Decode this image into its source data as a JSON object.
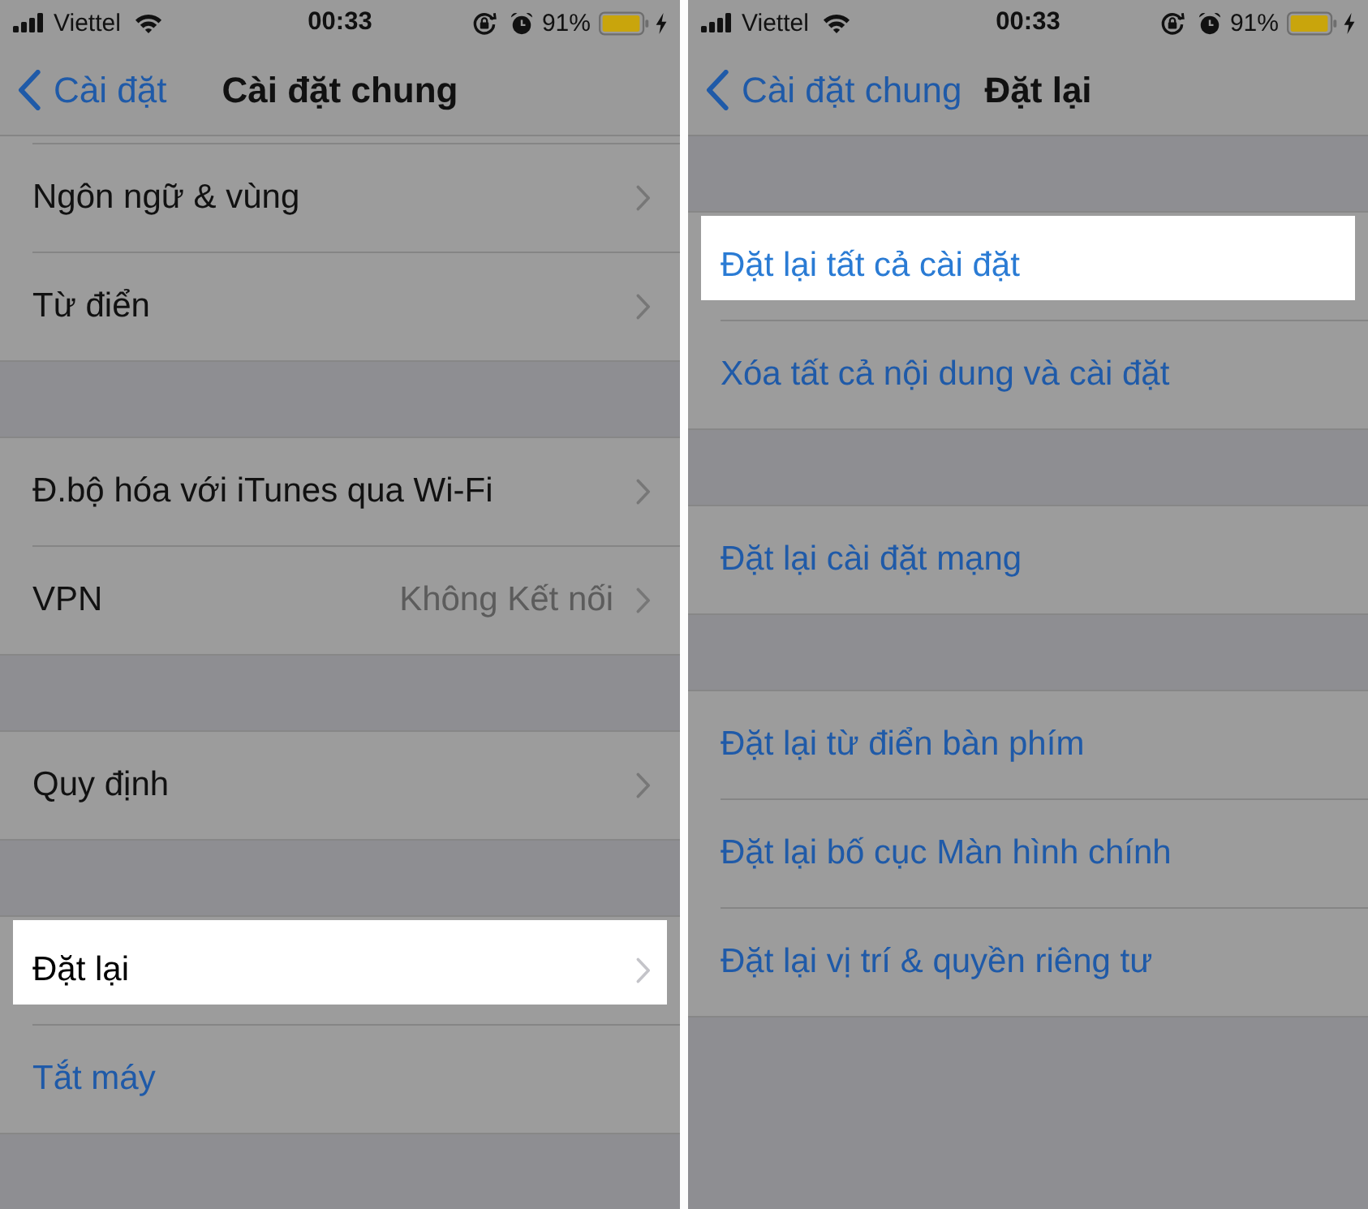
{
  "panels": [
    {
      "status_bar": {
        "carrier": "Viettel",
        "time": "00:33",
        "battery": "91%"
      },
      "nav": {
        "back": "Cài đặt",
        "title": "Cài đặt chung"
      },
      "groups": [
        {
          "clipped_top": true,
          "rows": [
            {
              "label": "Ngôn ngữ & vùng",
              "kind": "link",
              "selected": false
            },
            {
              "label": "Từ điển",
              "kind": "link",
              "selected": false
            }
          ]
        },
        {
          "clipped_top": false,
          "rows": [
            {
              "label": "Đ.bộ hóa với iTunes qua Wi-Fi",
              "kind": "link",
              "selected": false
            },
            {
              "label": "VPN",
              "kind": "link",
              "value": "Không Kết nối",
              "selected": false
            }
          ]
        },
        {
          "clipped_top": false,
          "rows": [
            {
              "label": "Quy định",
              "kind": "link",
              "selected": false
            }
          ]
        },
        {
          "clipped_top": false,
          "rows": [
            {
              "label": "Đặt lại",
              "kind": "link",
              "selected": true
            },
            {
              "label": "Tắt máy",
              "kind": "action",
              "selected": false
            }
          ]
        }
      ]
    },
    {
      "status_bar": {
        "carrier": "Viettel",
        "time": "00:33",
        "battery": "91%"
      },
      "nav": {
        "back": "Cài đặt chung",
        "title": "Đặt lại"
      },
      "groups": [
        {
          "clipped_top": false,
          "rows": [
            {
              "label": "Đặt lại tất cả cài đặt",
              "kind": "action",
              "selected": true
            },
            {
              "label": "Xóa tất cả nội dung và cài đặt",
              "kind": "action",
              "selected": false
            }
          ]
        },
        {
          "clipped_top": false,
          "rows": [
            {
              "label": "Đặt lại cài đặt mạng",
              "kind": "action",
              "selected": false
            }
          ]
        },
        {
          "clipped_top": false,
          "rows": [
            {
              "label": "Đặt lại từ điển bàn phím",
              "kind": "action",
              "selected": false
            },
            {
              "label": "Đặt lại bố cục Màn hình chính",
              "kind": "action",
              "selected": false
            },
            {
              "label": "Đặt lại vị trí & quyền riêng tư",
              "kind": "action",
              "selected": false
            }
          ]
        }
      ]
    }
  ]
}
